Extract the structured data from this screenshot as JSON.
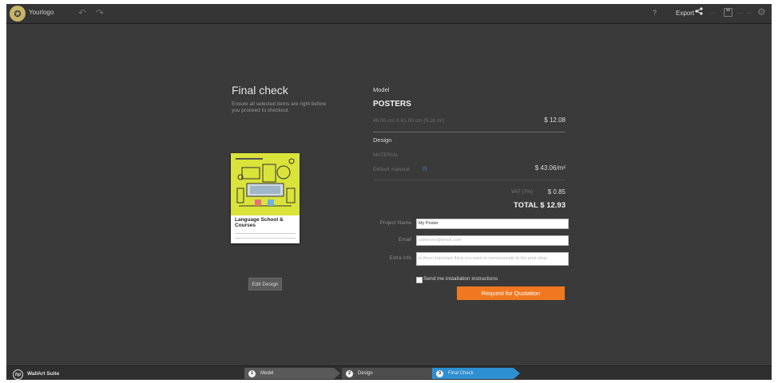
{
  "topbar": {
    "brand": "Yourlogo",
    "help": "?",
    "export_label": "Export",
    "faint_1": "—",
    "faint_2": "— —"
  },
  "left": {
    "title": "Final check",
    "subtitle": "Ensure all selected items are right before you proceed to checkout",
    "poster_title": "Language School & Courses",
    "edit_button": "Edit Design"
  },
  "summary": {
    "model_label": "Model",
    "model_name": "POSTERS",
    "dimensions": "46.00 cm X 61.00 cm (0.28 m²)",
    "model_price": "$ 12.08",
    "design_label": "Design",
    "material_label": "MATERIAL",
    "material_name": "Default material",
    "material_info": "(i)",
    "material_price": "$ 43.06/m²",
    "vat_label": "VAT (7%)",
    "vat_value": "$ 0.85",
    "total": "TOTAL  $ 12.93"
  },
  "form": {
    "project_label": "Project Name",
    "project_value": "My Poster",
    "email_label": "Email",
    "email_placeholder": "someone@email.com",
    "extra_label": "Extra info",
    "extra_placeholder": "Is there important thing you want to communicate to the print shop",
    "checkbox_label": "Send me installation instructions",
    "request_button": "Request for Quotation"
  },
  "bottombar": {
    "suite_name": "WallArt Suite",
    "steps": [
      {
        "num": "1",
        "label": "Model"
      },
      {
        "num": "2",
        "label": "Design"
      },
      {
        "num": "3",
        "label": "Final Check"
      }
    ]
  },
  "colors": {
    "accent": "#f07820",
    "active_step": "#2e8fd2",
    "background": "#3a3a3a"
  }
}
